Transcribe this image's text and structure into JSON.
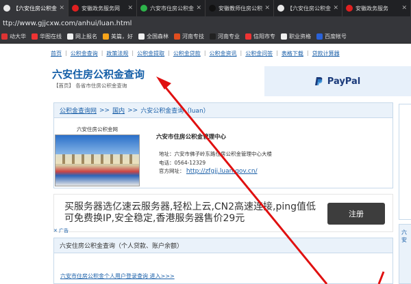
{
  "browser": {
    "tabs": [
      {
        "title": "【六安住房公积金",
        "color": "#e8e8e8",
        "active": true
      },
      {
        "title": "安徽政务服务网",
        "color": "#e02020",
        "active": false
      },
      {
        "title": "六安市住房公积金",
        "color": "#2db34a",
        "active": false
      },
      {
        "title": "安徽教师住房公积",
        "color": "#111111",
        "active": false
      },
      {
        "title": "【六安住房公积金",
        "color": "#e8e8e8",
        "active": false
      },
      {
        "title": "安徽政务服务",
        "color": "#e02020",
        "active": false
      }
    ],
    "url": "ttp://www.gjjcxw.com/anhui/luan.html",
    "bookmarks": [
      {
        "label": "动大华",
        "color": "#d33"
      },
      {
        "label": "华图在线",
        "color": "#e33"
      },
      {
        "label": "网上报名",
        "color": "#f0f0f0"
      },
      {
        "label": "美篇，好",
        "color": "#f7a41a"
      },
      {
        "label": "全国森林",
        "color": "#f0f0f0"
      },
      {
        "label": "河南专技",
        "color": "#e04d1e"
      },
      {
        "label": "河南专业",
        "color": "#222"
      },
      {
        "label": "信阳市专",
        "color": "#e33"
      },
      {
        "label": "职业资格",
        "color": "#f0f0f0"
      },
      {
        "label": "百度帐号",
        "color": "#2a62d8"
      }
    ]
  },
  "nav": [
    "首页",
    "公积金查询",
    "政策法规",
    "公积金提取",
    "公积金贷款",
    "公积金资讯",
    "公积金问答",
    "表格下载",
    "贷款计算器"
  ],
  "site": {
    "title": "六安住房公积金查询",
    "subtitle": "【首页】 各省市住房公积金查询"
  },
  "ad_paypal": {
    "label": "PayPal"
  },
  "breadcrumb": {
    "root": "公积金查询网",
    "sep": ">>",
    "mid": "国内",
    "cur": "六安公积金查询（luan）"
  },
  "center": {
    "thumb_caption": "六安住房公积金网",
    "name": "六安市住房公积金管理中心",
    "address": "地址：六安市佛子岭东路住房公积金管理中心大楼",
    "phone": "电话：0564-12329",
    "site_label": "官方网址：",
    "site_url": "http://zfgjj.luan.gov.cn/"
  },
  "ad_text": {
    "text": "买服务器选亿速云服务器,轻松上云,CN2高速连接,ping值低可免费换IP,安全稳定,香港服务器售价29元",
    "button": "注册",
    "mark": "✕ 广告"
  },
  "query_box": {
    "header": "六安住房公积金查询（个人贷款、账户余额）",
    "link": "六安市住房公积金个人用户登录查询    进入>>>"
  },
  "right_frag": "六安"
}
